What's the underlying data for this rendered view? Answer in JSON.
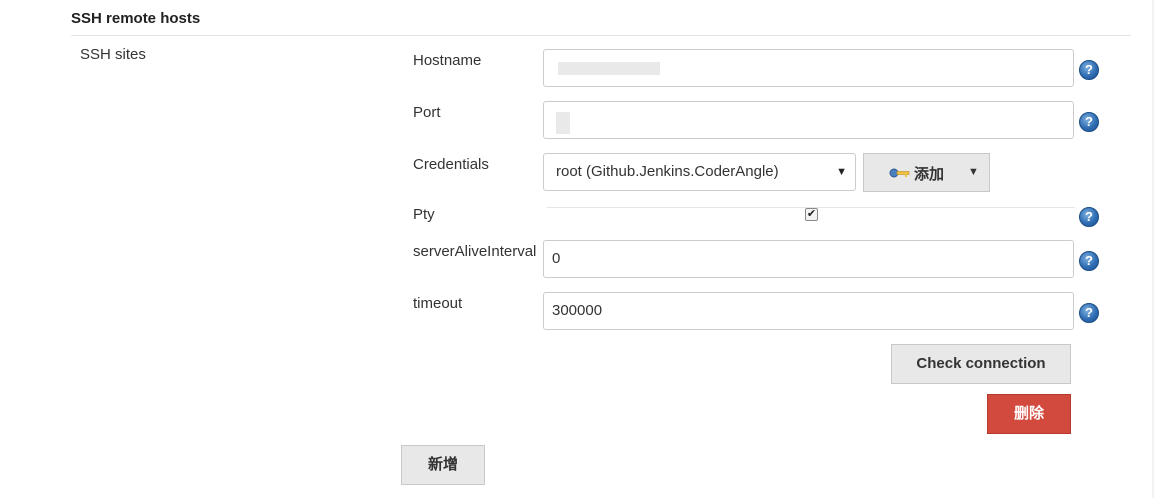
{
  "section": {
    "title": "SSH remote hosts"
  },
  "sites_label": "SSH sites",
  "fields": {
    "hostname": {
      "label": "Hostname",
      "value": ""
    },
    "port": {
      "label": "Port",
      "value": ""
    },
    "credentials": {
      "label": "Credentials",
      "selected": "root (Github.Jenkins.CoderAngle)",
      "add_label": "添加"
    },
    "pty": {
      "label": "Pty",
      "checked": true,
      "check_glyph": "✔"
    },
    "server_alive": {
      "label": "serverAliveInterval",
      "value": "0"
    },
    "timeout": {
      "label": "timeout",
      "value": "300000"
    }
  },
  "help_glyph": "?",
  "buttons": {
    "check_connection": "Check connection",
    "delete": "删除",
    "add_new": "新增"
  },
  "icons": {
    "help": "help-icon",
    "key": "key-icon",
    "select_arrow": "select-arrow-icon",
    "dropdown": "chevron-down-icon"
  },
  "colors": {
    "help_icon": "#2f6db3",
    "delete_button": "#d24a3d",
    "button_gray": "#e8e8e8",
    "border": "#cccccc"
  }
}
